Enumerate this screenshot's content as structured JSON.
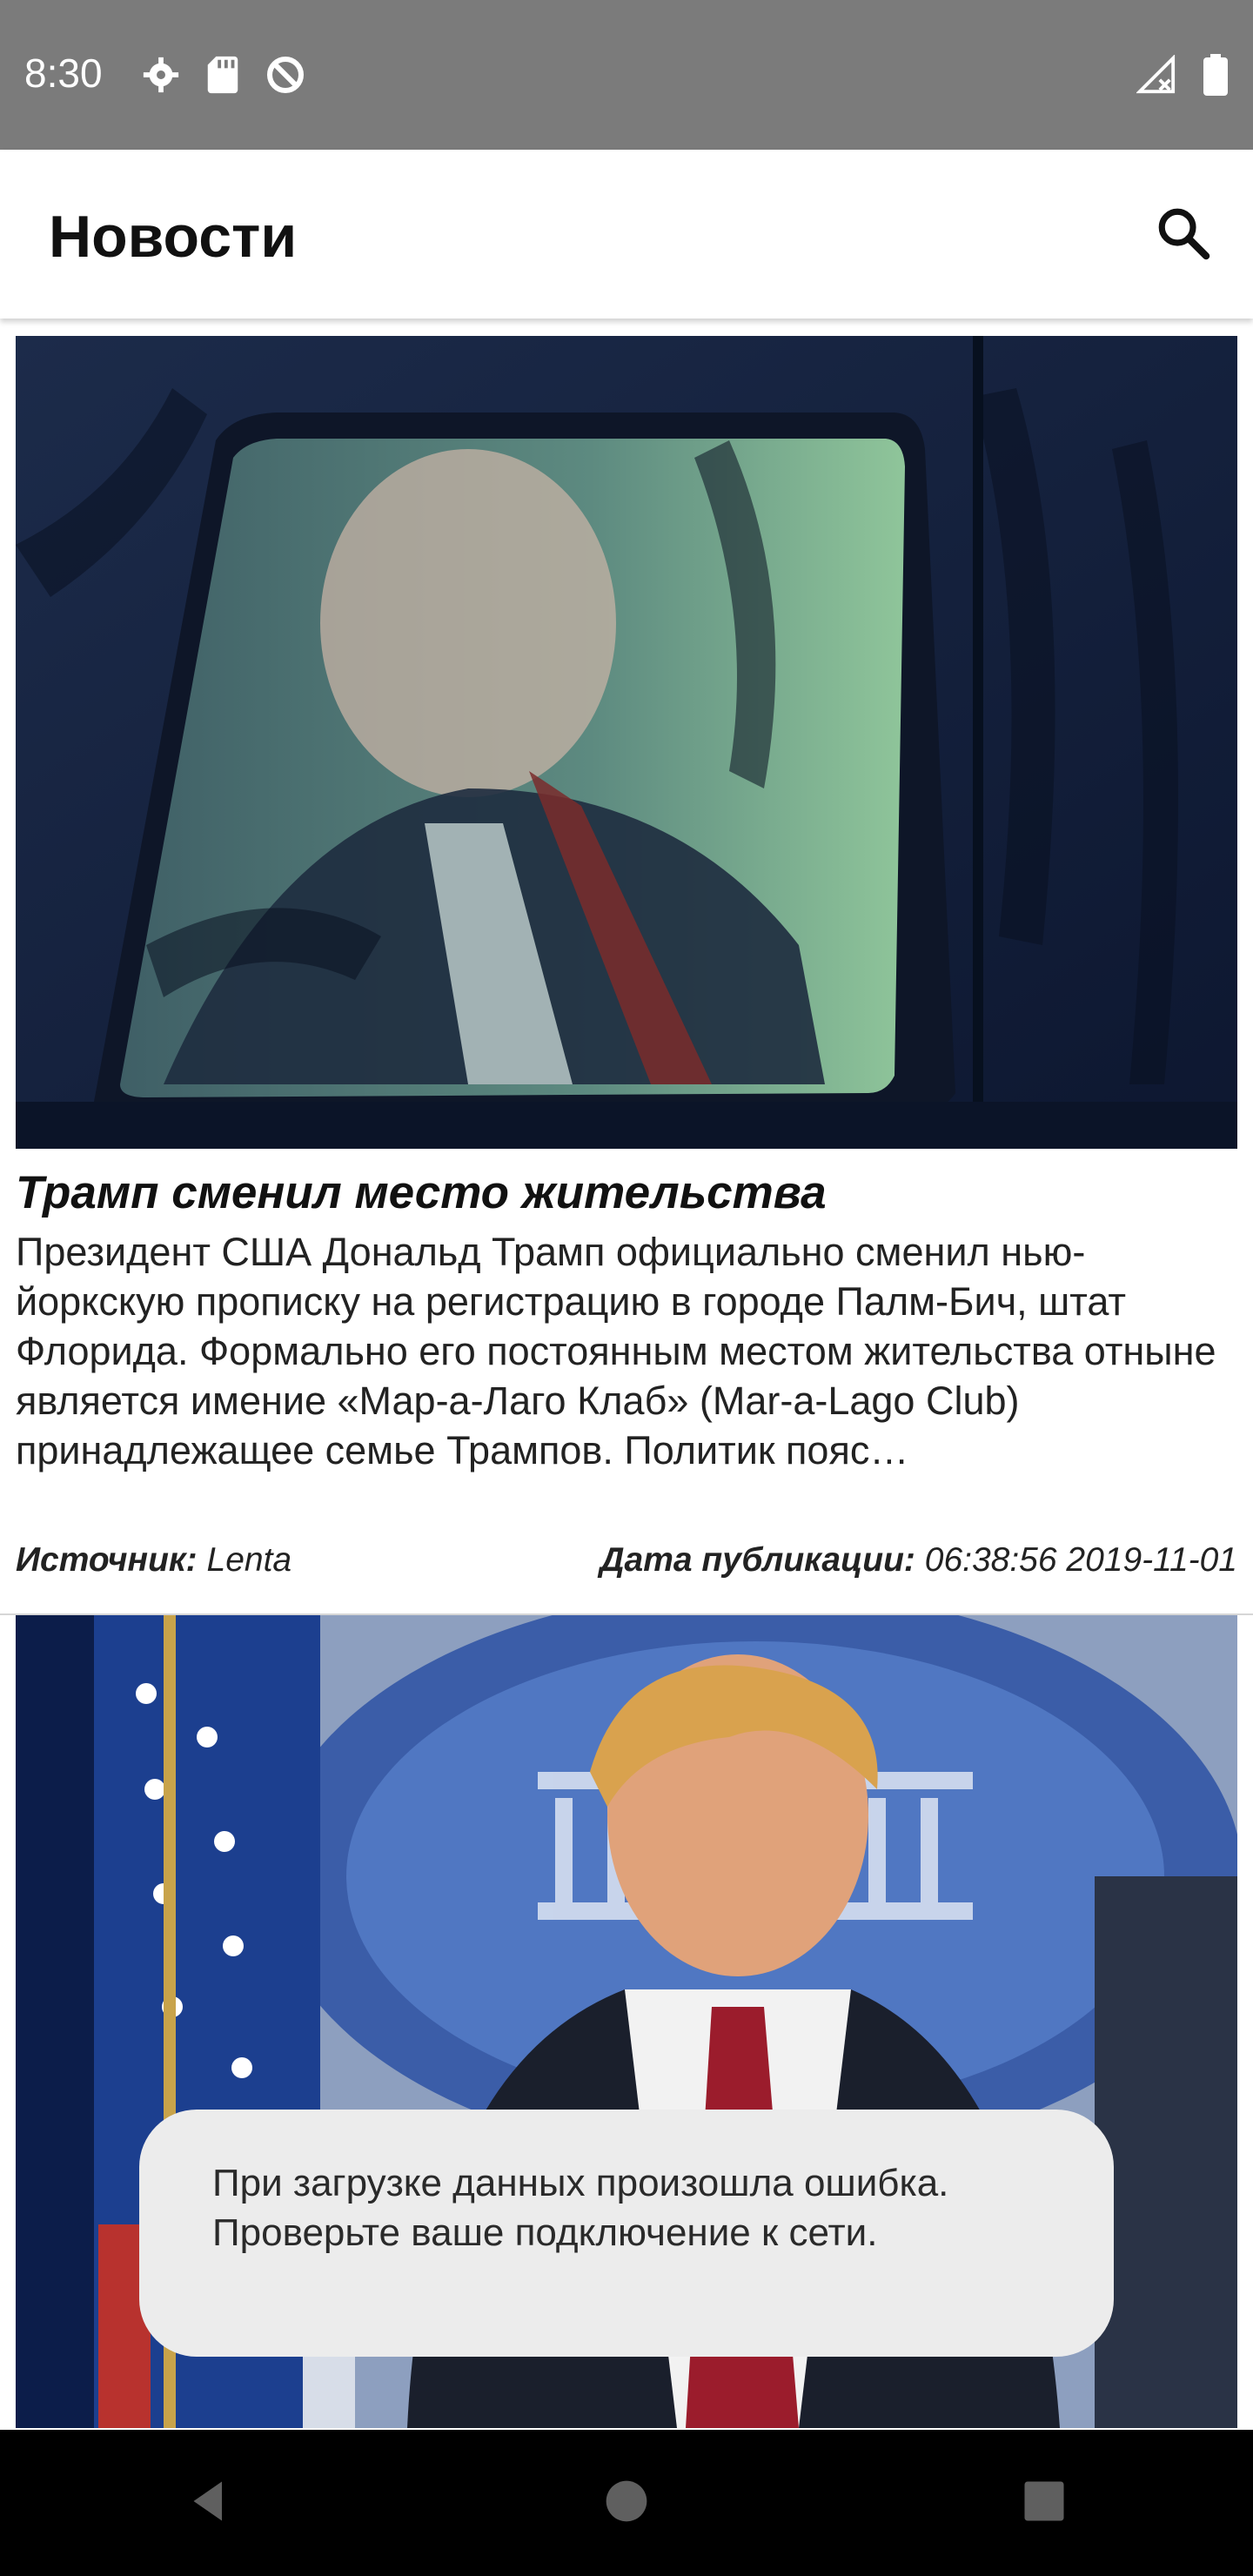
{
  "status_bar": {
    "time": "8:30",
    "left_icons": [
      "settings-gear-icon",
      "sd-card-icon",
      "sync-blocked-icon"
    ],
    "right_icons": [
      "signal-off-icon",
      "battery-icon"
    ]
  },
  "app_bar": {
    "title": "Новости",
    "search_icon": "search-icon"
  },
  "articles": [
    {
      "title": "Трамп сменил место жительства",
      "text": "Президент США Дональд Трамп официально сменил нью-йоркскую прописку на регистрацию в городе Палм-Бич, штат Флорида. Формально его постоянным местом жительства отныне является имение «Мар-а-Лаго Клаб» (Mar-a-Lago Club) принадлежащее семье Трампов. Политик пояс…",
      "source_label": "Источник:",
      "source": "Lenta",
      "date_label": "Дата публикации:",
      "date": "06:38:56 2019-11-01",
      "image": "car-window-photo"
    },
    {
      "image": "press-briefing-photo"
    }
  ],
  "toast": {
    "message": "При загрузке данных произошла ошибка. Проверьте ваше подключение к сети."
  },
  "nav_bar": {
    "icons": [
      "back-icon",
      "home-icon",
      "recents-icon"
    ]
  },
  "colors": {
    "status_bar": "#7b7b7b",
    "toast_bg": "#ececec",
    "nav_bar": "#000000"
  }
}
